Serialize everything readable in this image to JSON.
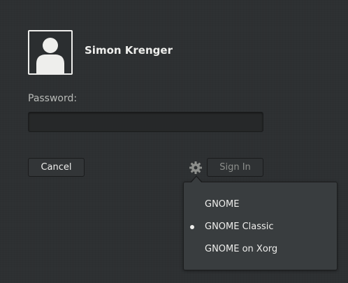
{
  "user": {
    "name": "Simon Krenger"
  },
  "password": {
    "label": "Password:",
    "value": ""
  },
  "buttons": {
    "cancel": "Cancel",
    "sign_in": "Sign In"
  },
  "session_menu": {
    "icon": "gear-icon",
    "items": [
      {
        "label": "GNOME",
        "selected": false
      },
      {
        "label": "GNOME Classic",
        "selected": true
      },
      {
        "label": "GNOME on Xorg",
        "selected": false
      }
    ]
  },
  "colors": {
    "background": "#2d3032",
    "text": "#eeeeec",
    "popover": "#393d3f"
  }
}
